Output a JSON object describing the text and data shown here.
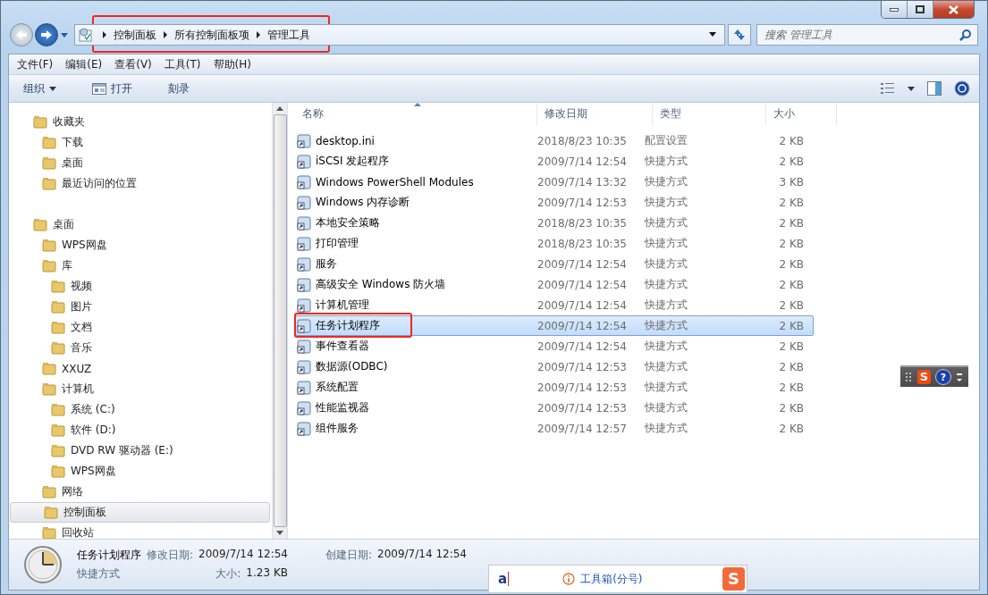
{
  "navigation": {
    "breadcrumb": [
      "控制面板",
      "所有控制面板项",
      "管理工具"
    ],
    "highlighted": true,
    "search": {
      "placeholder": "搜索 管理工具"
    }
  },
  "menu": [
    "文件(F)",
    "编辑(E)",
    "查看(V)",
    "工具(T)",
    "帮助(H)"
  ],
  "toolbar": [
    {
      "label": "组织",
      "dropdown": true,
      "icon": false
    },
    {
      "label": "打开",
      "dropdown": false,
      "icon": true
    },
    {
      "label": "刻录",
      "dropdown": false,
      "icon": false
    }
  ],
  "sidebar": {
    "items": [
      {
        "label": "收藏夹",
        "selected": false,
        "children": [
          {
            "label": "下载",
            "selected": false
          },
          {
            "label": "桌面",
            "selected": false
          },
          {
            "label": "最近访问的位置",
            "selected": false
          }
        ]
      },
      {
        "label": "桌面",
        "selected": false,
        "children": [
          {
            "label": "WPS网盘",
            "selected": false
          },
          {
            "label": "库",
            "selected": false,
            "children": [
              {
                "label": "视频",
                "selected": false
              },
              {
                "label": "图片",
                "selected": false
              },
              {
                "label": "文档",
                "selected": false
              },
              {
                "label": "音乐",
                "selected": false
              }
            ]
          },
          {
            "label": "XXUZ",
            "selected": false
          },
          {
            "label": "计算机",
            "selected": false,
            "children": [
              {
                "label": "系统 (C:)",
                "selected": false
              },
              {
                "label": "软件 (D:)",
                "selected": false
              },
              {
                "label": "DVD RW 驱动器 (E:)",
                "selected": false
              },
              {
                "label": "WPS网盘",
                "selected": false
              }
            ]
          },
          {
            "label": "网络",
            "selected": false
          },
          {
            "label": "控制面板",
            "selected": true
          },
          {
            "label": "回收站",
            "selected": false
          }
        ]
      }
    ]
  },
  "table": {
    "columns": [
      "名称",
      "修改日期",
      "类型",
      "大小"
    ],
    "rows": [
      {
        "name": "desktop.ini",
        "modified": "2018/8/23 10:35",
        "type": "配置设置",
        "size": "2 KB",
        "selected": false,
        "highlighted": false
      },
      {
        "name": "iSCSI 发起程序",
        "modified": "2009/7/14 12:54",
        "type": "快捷方式",
        "size": "2 KB",
        "selected": false,
        "highlighted": false
      },
      {
        "name": "Windows PowerShell Modules",
        "modified": "2009/7/14 13:32",
        "type": "快捷方式",
        "size": "3 KB",
        "selected": false,
        "highlighted": false
      },
      {
        "name": "Windows 内存诊断",
        "modified": "2009/7/14 12:53",
        "type": "快捷方式",
        "size": "2 KB",
        "selected": false,
        "highlighted": false
      },
      {
        "name": "本地安全策略",
        "modified": "2018/8/23 10:35",
        "type": "快捷方式",
        "size": "2 KB",
        "selected": false,
        "highlighted": false
      },
      {
        "name": "打印管理",
        "modified": "2018/8/23 10:35",
        "type": "快捷方式",
        "size": "2 KB",
        "selected": false,
        "highlighted": false
      },
      {
        "name": "服务",
        "modified": "2009/7/14 12:54",
        "type": "快捷方式",
        "size": "2 KB",
        "selected": false,
        "highlighted": false
      },
      {
        "name": "高级安全 Windows 防火墙",
        "modified": "2009/7/14 12:54",
        "type": "快捷方式",
        "size": "2 KB",
        "selected": false,
        "highlighted": false
      },
      {
        "name": "计算机管理",
        "modified": "2009/7/14 12:54",
        "type": "快捷方式",
        "size": "2 KB",
        "selected": false,
        "highlighted": false
      },
      {
        "name": "任务计划程序",
        "modified": "2009/7/14 12:54",
        "type": "快捷方式",
        "size": "2 KB",
        "selected": true,
        "highlighted": true
      },
      {
        "name": "事件查看器",
        "modified": "2009/7/14 12:54",
        "type": "快捷方式",
        "size": "2 KB",
        "selected": false,
        "highlighted": false
      },
      {
        "name": "数据源(ODBC)",
        "modified": "2009/7/14 12:53",
        "type": "快捷方式",
        "size": "2 KB",
        "selected": false,
        "highlighted": false
      },
      {
        "name": "系统配置",
        "modified": "2009/7/14 12:53",
        "type": "快捷方式",
        "size": "2 KB",
        "selected": false,
        "highlighted": false
      },
      {
        "name": "性能监视器",
        "modified": "2009/7/14 12:53",
        "type": "快捷方式",
        "size": "2 KB",
        "selected": false,
        "highlighted": false
      },
      {
        "name": "组件服务",
        "modified": "2009/7/14 12:57",
        "type": "快捷方式",
        "size": "2 KB",
        "selected": false,
        "highlighted": false
      }
    ]
  },
  "status_bar": {
    "name": "任务计划程序",
    "kind": "快捷方式",
    "fields": [
      {
        "label": "修改日期:",
        "value": "2009/7/14 12:54"
      },
      {
        "label": "大小:",
        "value": "1.23 KB"
      },
      {
        "label": "创建日期:",
        "value": "2009/7/14 12:54"
      }
    ]
  },
  "ime": {
    "input": "a",
    "hint": "工具箱(分号)",
    "logo": "S"
  },
  "ime_toolbar": {
    "logo": "S",
    "help": "?"
  }
}
